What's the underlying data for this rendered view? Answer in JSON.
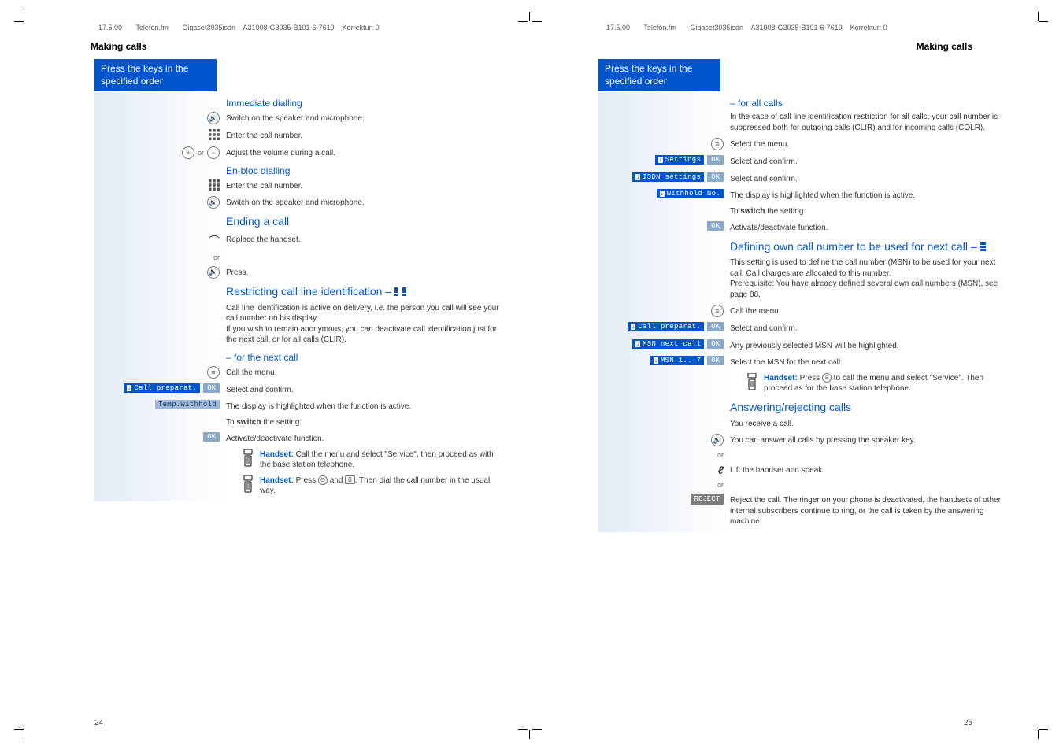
{
  "header": {
    "date": "17.5.00",
    "file": "Telefon.fm",
    "model": "Gigaset3035isdn",
    "doc_id": "A31008-G3035-B101-6-7619",
    "korrektur": "Korrektur: 0"
  },
  "section_title": "Making calls",
  "instruction_box": "Press the keys in the specified order",
  "left": {
    "h_immediate": "Immediate dialling",
    "imm1": "Switch on the speaker and microphone.",
    "imm2": "Enter the call number.",
    "imm3": "Adjust the volume during a call.",
    "h_enbloc": "En-bloc dialling",
    "en1": "Enter the call number.",
    "en2": "Switch on the speaker and microphone.",
    "h_ending": "Ending a call",
    "end1": "Replace the handset.",
    "or": "or",
    "end2": "Press.",
    "h_restrict": "Restricting call line identification – ",
    "restrict_body": "Call line identification is active on delivery, i.e. the person you call will see your call number on his display.\nIf you wish to remain anonymous, you can deactivate call identification just for the next call, or for all calls (CLIR).",
    "h_next": "– for the next call",
    "nx1": "Call the menu.",
    "nx2_label": "Call preparat.",
    "nx2": "Select and confirm.",
    "nx3_label": "Temp.withhold",
    "nx3": "The display is highlighted when the function is active.",
    "nx_switch": "To switch the setting:",
    "nx4": "Activate/deactivate function.",
    "note1": "Handset: Call the menu and select \"Service\", then proceed as with the base station telephone.",
    "note2_a": "Handset:",
    "note2_b": " Press ",
    "note2_c": " and ",
    "note2_d": ". Then dial the call number in the usual way."
  },
  "right": {
    "h_all": "– for all calls",
    "all_body": "In the case of call line identification restriction for all calls, your call number is suppressed both for outgoing calls (CLIR) and for incoming calls (COLR).",
    "all1": "Select the menu.",
    "all2_label": "Settings",
    "all2": "Select and confirm.",
    "all3_label": "ISDN settings",
    "all3": "Select and confirm.",
    "all4_label": "Withhold No.",
    "all4": "The display is highlighted when the function is active.",
    "all_switch": "To switch the setting:",
    "all5": "Activate/deactivate function.",
    "h_own": "Defining own call number to be used for next call – ",
    "own_body": "This setting is used to define the call number (MSN) to be used for your next call. Call charges are allocated to this number.\nPrerequisite: You have already defined several own call numbers (MSN), see page 88.",
    "own1": "Call the menu.",
    "own2_label": "Call preparat.",
    "own2": "Select and confirm.",
    "own3_label": "MSN next call",
    "own3": "Any previously selected MSN will be highlighted.",
    "own4_label": "MSN 1...7",
    "own4": "Select the MSN for the next call.",
    "own_note_a": "Handset:",
    "own_note_b": " Press ",
    "own_note_c": " to call the menu and select \"Service\". Then proceed as for the base station telephone.",
    "h_ans": "Answering/rejecting calls",
    "ans_body": "You receive a call.",
    "ans1": "You can answer all calls by pressing the speaker key.",
    "or": "or",
    "ans2": "Lift the handset and speak.",
    "ans3_label": "REJECT",
    "ans3": "Reject the call. The ringer on your phone is deactivated, the handsets of other internal subscribers continue to ring, or the call is taken by the answering machine."
  },
  "page_left": "24",
  "page_right": "25"
}
